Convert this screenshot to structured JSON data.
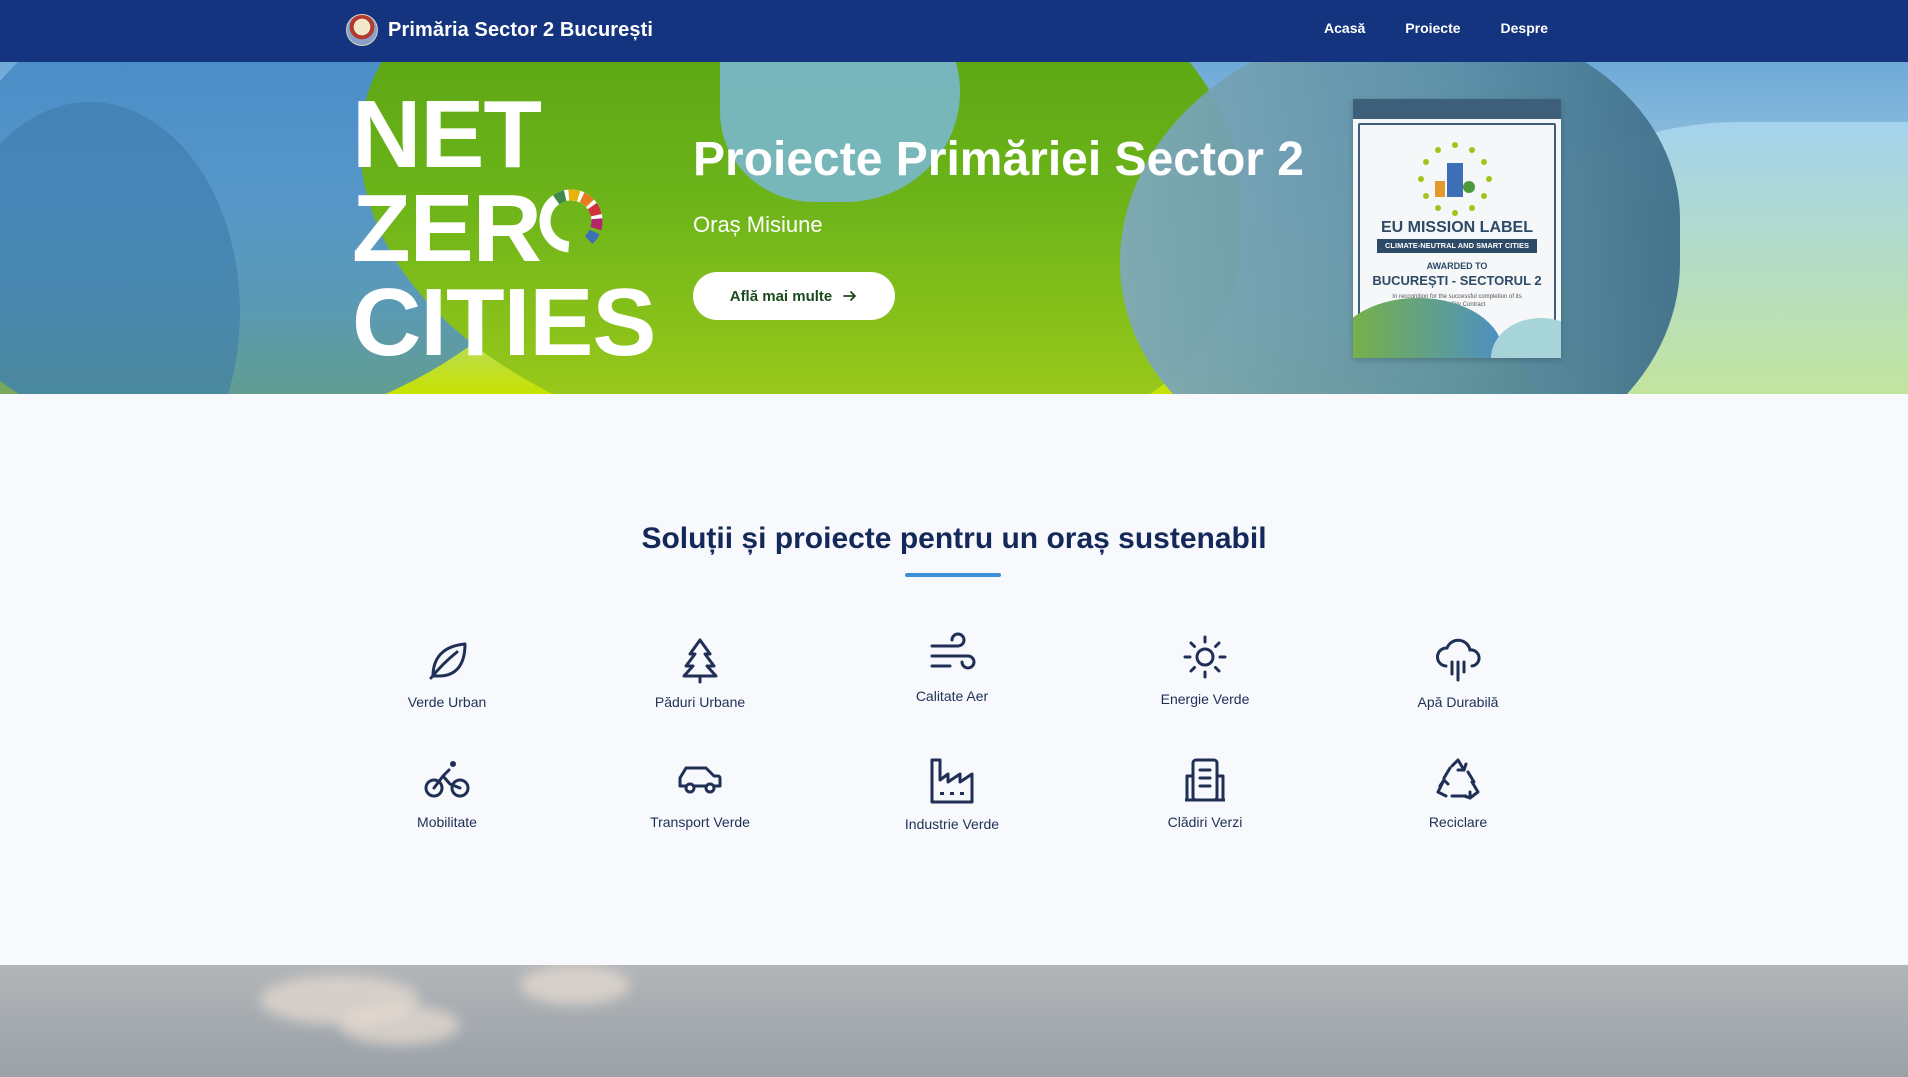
{
  "nav": {
    "brand": "Primăria Sector 2 București",
    "links": [
      "Acasă",
      "Proiecte",
      "Despre"
    ]
  },
  "hero": {
    "logo_lines": [
      "NET",
      "ZER",
      "CITIES"
    ],
    "title": "Proiecte Primăriei Sector 2",
    "subtitle": "Oraș Misiune",
    "cta": "Află mai multe",
    "certificate": {
      "title": "EU MISSION LABEL",
      "band": "CLIMATE-NEUTRAL AND SMART CITIES",
      "awarded": "AWARDED TO",
      "city": "BUCUREȘTI - SECTORUL 2",
      "note": "In recognition for the successful completion of its Climate City Contract"
    }
  },
  "solutions": {
    "title": "Soluții și proiecte pentru un oraș sustenabil",
    "items": [
      {
        "label": "Verde Urban",
        "icon": "leaf-icon"
      },
      {
        "label": "Păduri Urbane",
        "icon": "tree-icon"
      },
      {
        "label": "Calitate Aer",
        "icon": "wind-icon"
      },
      {
        "label": "Energie Verde",
        "icon": "sun-icon"
      },
      {
        "label": "Apă Durabilă",
        "icon": "rain-cloud-icon"
      },
      {
        "label": "Mobilitate",
        "icon": "bicycle-icon"
      },
      {
        "label": "Transport Verde",
        "icon": "car-icon"
      },
      {
        "label": "Industrie Verde",
        "icon": "factory-icon"
      },
      {
        "label": "Clădiri Verzi",
        "icon": "building-icon"
      },
      {
        "label": "Reciclare",
        "icon": "recycle-icon"
      }
    ]
  },
  "colors": {
    "nav_bg": "#14347f",
    "heading": "#14285a",
    "accent": "#3a8fd6"
  }
}
